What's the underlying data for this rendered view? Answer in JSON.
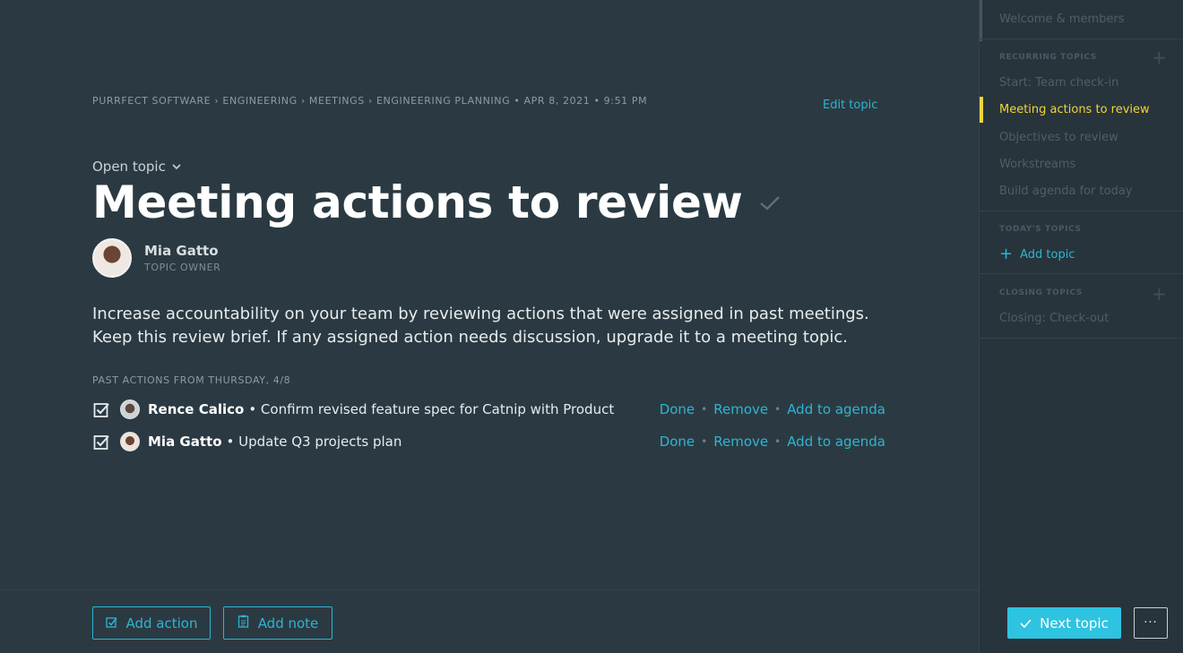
{
  "breadcrumb": "PURRFECT SOFTWARE › ENGINEERING › MEETINGS › ENGINEERING PLANNING • APR 8, 2021 • 9:51 PM",
  "header": {
    "edit_topic": "Edit topic",
    "open_topic": "Open topic",
    "title": "Meeting actions to review"
  },
  "owner": {
    "name": "Mia Gatto",
    "role": "TOPIC OWNER"
  },
  "description": "Increase accountability on your team by reviewing actions that were assigned in past meetings. Keep this review brief. If any assigned action needs discussion, upgrade it to a meeting topic.",
  "past_actions": {
    "label": "PAST ACTIONS FROM THURSDAY, 4/8",
    "items": [
      {
        "assignee": "Rence Calico",
        "text": "• Confirm revised feature spec for Catnip with Product",
        "done": "Done",
        "remove": "Remove",
        "add_to_agenda": "Add to agenda"
      },
      {
        "assignee": "Mia Gatto",
        "text": "• Update Q3 projects plan",
        "done": "Done",
        "remove": "Remove",
        "add_to_agenda": "Add to agenda"
      }
    ],
    "separator": "•"
  },
  "footer": {
    "add_action": "Add action",
    "add_note": "Add note",
    "next_topic": "Next topic",
    "more": "···"
  },
  "sidebar": {
    "welcome": "Welcome & members",
    "recurring_heading": "RECURRING TOPICS",
    "recurring_items": [
      "Start: Team check-in",
      "Meeting actions to review",
      "Objectives to review",
      "Workstreams",
      "Build agenda for today"
    ],
    "todays_heading": "TODAY'S TOPICS",
    "add_topic": "Add topic",
    "closing_heading": "CLOSING TOPICS",
    "closing_items": [
      "Closing: Check-out"
    ]
  },
  "colors": {
    "accent": "#2fb4d2",
    "active": "#f2d43a",
    "background": "#2b3a42"
  }
}
